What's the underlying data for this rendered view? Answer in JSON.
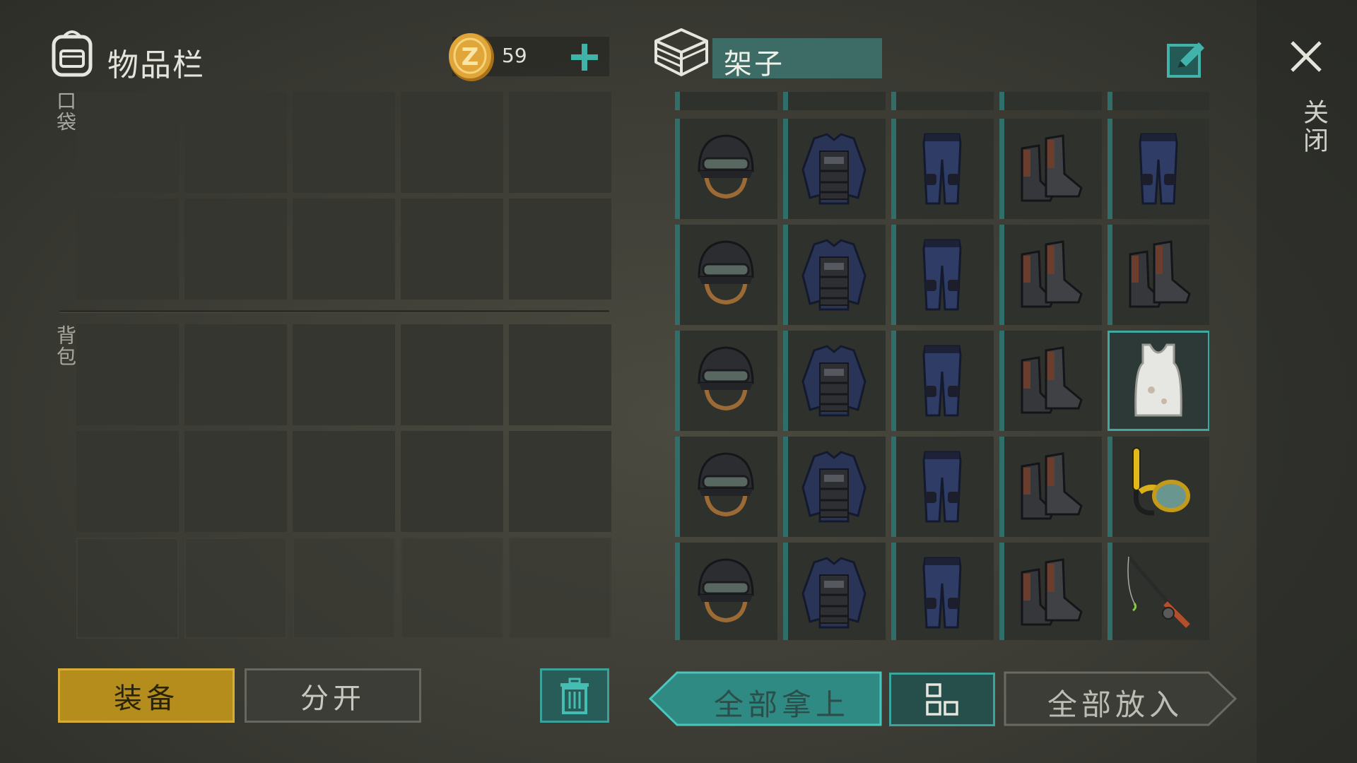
{
  "header": {
    "inventory_title": "物品栏",
    "coins": "59",
    "shelf_title": "架子"
  },
  "sections": {
    "pocket_label": "口袋",
    "backpack_label": "背包"
  },
  "close_label": "关闭",
  "buttons": {
    "equip": "装备",
    "split": "分开",
    "take_all": "全部拿上",
    "put_all": "全部放入"
  },
  "shelf": {
    "columns": 5,
    "rows": [
      [
        "helmet",
        "tactical-vest",
        "police-pants",
        "boots",
        "police-pants"
      ],
      [
        "helmet",
        "tactical-vest",
        "police-pants",
        "boots",
        "boots"
      ],
      [
        "helmet",
        "tactical-vest",
        "police-pants",
        "boots",
        "tank-top"
      ],
      [
        "helmet",
        "tactical-vest",
        "police-pants",
        "boots",
        "snorkel-mask"
      ],
      [
        "helmet",
        "tactical-vest",
        "police-pants",
        "boots",
        "fishing-rod"
      ]
    ],
    "selected_item": "tank-top"
  },
  "colors": {
    "accent_teal": "#3fa9a1",
    "equip_gold": "#b58d1d"
  }
}
